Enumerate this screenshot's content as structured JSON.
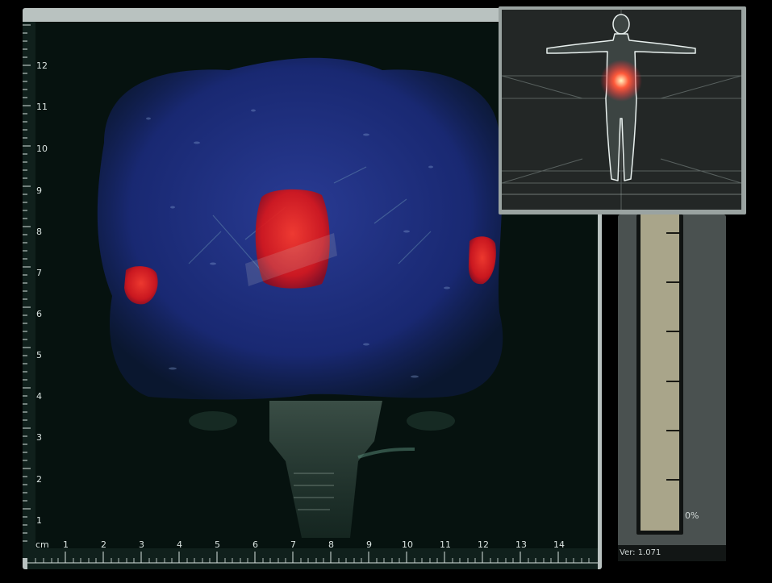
{
  "viewer": {
    "ruler_unit": "cm",
    "x_ticks": [
      "1",
      "2",
      "3",
      "4",
      "5",
      "6",
      "7",
      "8",
      "9",
      "10",
      "11",
      "12",
      "13",
      "14"
    ],
    "y_ticks": [
      "12",
      "11",
      "10",
      "9",
      "8",
      "7",
      "6",
      "5",
      "4",
      "3",
      "2",
      "1"
    ]
  },
  "gauge": {
    "percent_label": "0%",
    "level": 0
  },
  "footer": {
    "version_label": "Ver: 1.071"
  },
  "colors": {
    "frame": "#b9c2c0",
    "volume_blue": "#1d2f8a",
    "hotspot_red": "#e3161a",
    "gauge_fill": "#a9a58a"
  }
}
